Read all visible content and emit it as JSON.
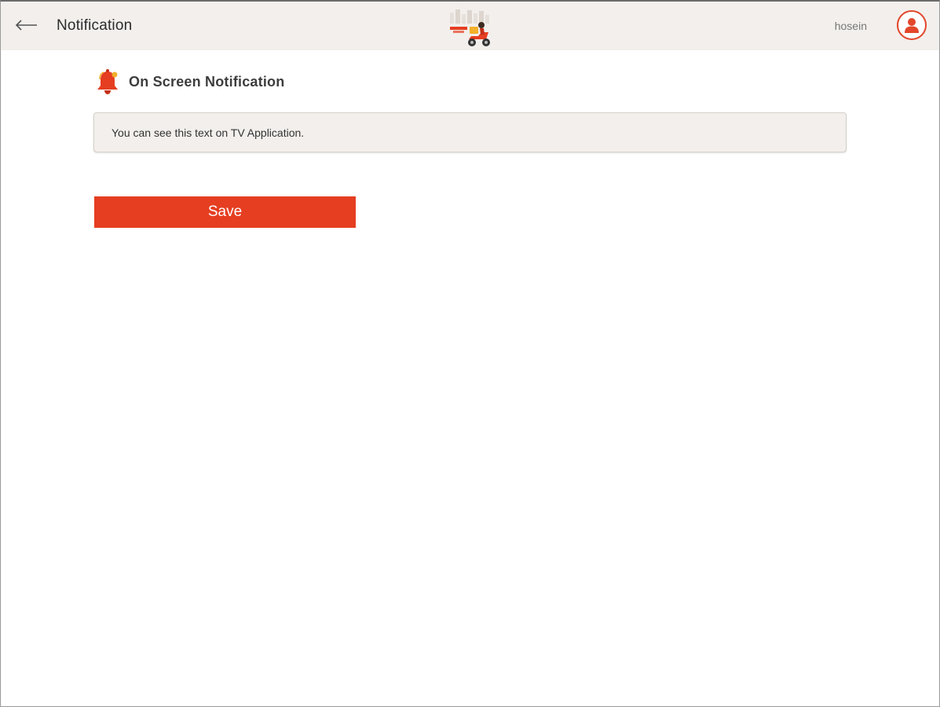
{
  "header": {
    "title": "Notification",
    "username": "hosein",
    "back_icon": "arrow-left-icon",
    "logo_icon": "delivery-scooter-logo",
    "avatar_icon": "user-avatar-icon"
  },
  "section": {
    "title": "On Screen Notification",
    "icon": "bell-icon"
  },
  "notification_field": {
    "value": "You can see this text on TV Application."
  },
  "actions": {
    "save_label": "Save"
  },
  "colors": {
    "accent": "#e53e21",
    "header_bg": "#f2efec",
    "field_bg": "#f2efec"
  }
}
